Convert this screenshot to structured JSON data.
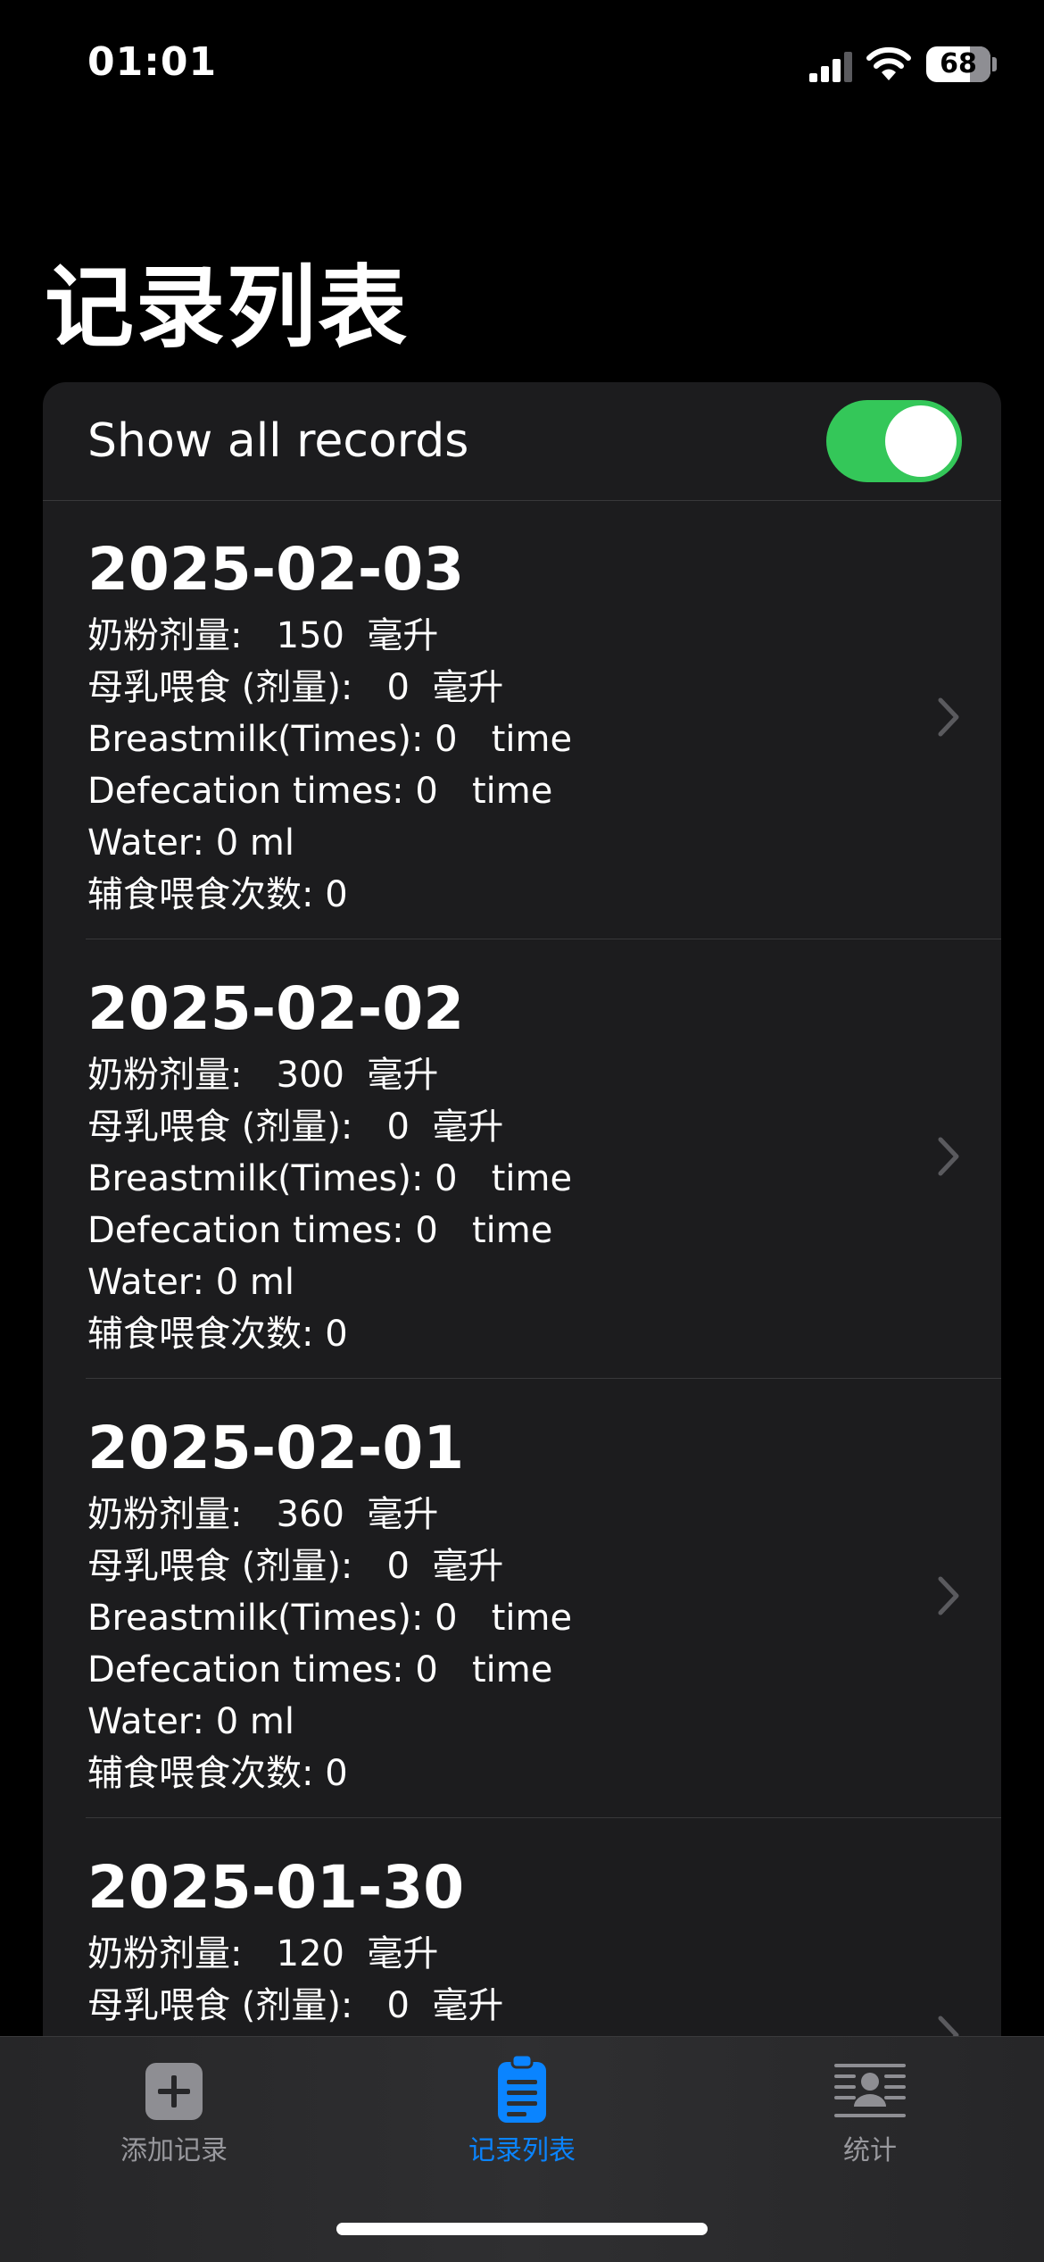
{
  "status_bar": {
    "time": "01:01",
    "battery_level": "68",
    "battery_fraction": 0.68
  },
  "page": {
    "title": "记录列表"
  },
  "settings": {
    "show_all_label": "Show all records",
    "show_all_enabled": true
  },
  "records": [
    {
      "date": "2025-02-03",
      "formula": "奶粉剂量:   150  毫升",
      "breastmilk_amount": "母乳喂食 (剂量):   0  毫升",
      "breastmilk_times": "Breastmilk(Times): 0   time",
      "defecation": "Defecation times: 0   time",
      "water": "Water: 0 ml",
      "solid_food": "辅食喂食次数: 0"
    },
    {
      "date": "2025-02-02",
      "formula": "奶粉剂量:   300  毫升",
      "breastmilk_amount": "母乳喂食 (剂量):   0  毫升",
      "breastmilk_times": "Breastmilk(Times): 0   time",
      "defecation": "Defecation times: 0   time",
      "water": "Water: 0 ml",
      "solid_food": "辅食喂食次数: 0"
    },
    {
      "date": "2025-02-01",
      "formula": "奶粉剂量:   360  毫升",
      "breastmilk_amount": "母乳喂食 (剂量):   0  毫升",
      "breastmilk_times": "Breastmilk(Times): 0   time",
      "defecation": "Defecation times: 0   time",
      "water": "Water: 0 ml",
      "solid_food": "辅食喂食次数: 0"
    },
    {
      "date": "2025-01-30",
      "formula": "奶粉剂量:   120  毫升",
      "breastmilk_amount": "母乳喂食 (剂量):   0  毫升"
    }
  ],
  "tabs": [
    {
      "label": "添加记录",
      "icon": "plus-square-icon",
      "active": false
    },
    {
      "label": "记录列表",
      "icon": "clipboard-list-icon",
      "active": true
    },
    {
      "label": "统计",
      "icon": "stats-person-icon",
      "active": false
    }
  ],
  "colors": {
    "accent": "#0a84ff",
    "toggle_on": "#34c759",
    "background": "#000000",
    "card": "#1c1c1e",
    "tab_inactive": "#98989d"
  }
}
